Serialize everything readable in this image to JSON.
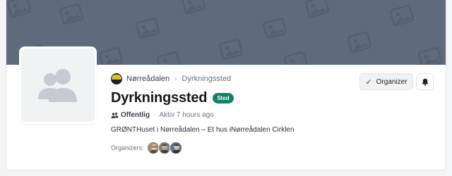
{
  "breadcrumb": {
    "org": "Nørreådalen",
    "separator": "›",
    "current": "Dyrkningssted"
  },
  "title": "Dyrkningssted",
  "badge": "Sted",
  "meta": {
    "visibility_icon": "people-icon",
    "visibility": "Offentlig",
    "separator": "·",
    "active": "Aktiv 7 hours ago"
  },
  "description": "GRØNTHuset i Nørreådalen – Et hus iNørreådalen Cirklen",
  "organizers": {
    "label": "Organizers:",
    "avatars": [
      "organizer-1",
      "organizer-2",
      "organizer-3"
    ]
  },
  "actions": {
    "organize_label": "Organizer",
    "check_icon": "check-icon",
    "bell_icon": "bell-icon"
  },
  "colors": {
    "cover": "#5f6b7c",
    "badge": "#12826a",
    "logo_yellow": "#d8c12a"
  }
}
